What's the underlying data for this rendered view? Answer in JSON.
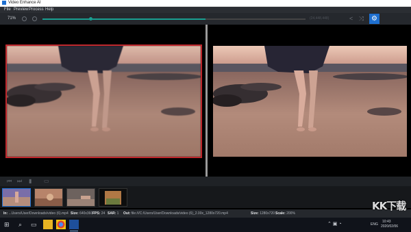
{
  "titlebar": {
    "title": "Video Enhance AI"
  },
  "menu": [
    "File",
    "Preview",
    "Process",
    "Help"
  ],
  "toolbar": {
    "zoom": "71%",
    "progress_label": "(24,448,448)",
    "progress": 0.62
  },
  "status": {
    "in_label": "In:",
    "in_value": "...Users/User/Downloads/video (6).mp4",
    "size_label": "Size:",
    "size_value": "640x360",
    "fps_label": "FPS:",
    "fps_value": "24",
    "sar_label": "SAR:",
    "sar_value": "1",
    "out_label": "Out:",
    "out_value": "file:///C:/Users/User/Downloads/video (6)_2.00x_1280x720.mp4",
    "out_size_label": "Size:",
    "out_size_value": "1280x720",
    "scale_label": "Scale:",
    "scale_value": "200%"
  },
  "taskbar": {
    "lang": "ENG",
    "time": "10:43",
    "date": "2020/02/06"
  },
  "watermark": "KK下载",
  "colors": {
    "accent": "#1e6fd0",
    "progress": "#1aa092",
    "selection": "#c0282d"
  },
  "icons": {
    "gear": "gear-icon",
    "share": "share-icon",
    "shuffle": "shuffle-icon",
    "start": "windows-start-icon",
    "search": "search-icon"
  }
}
